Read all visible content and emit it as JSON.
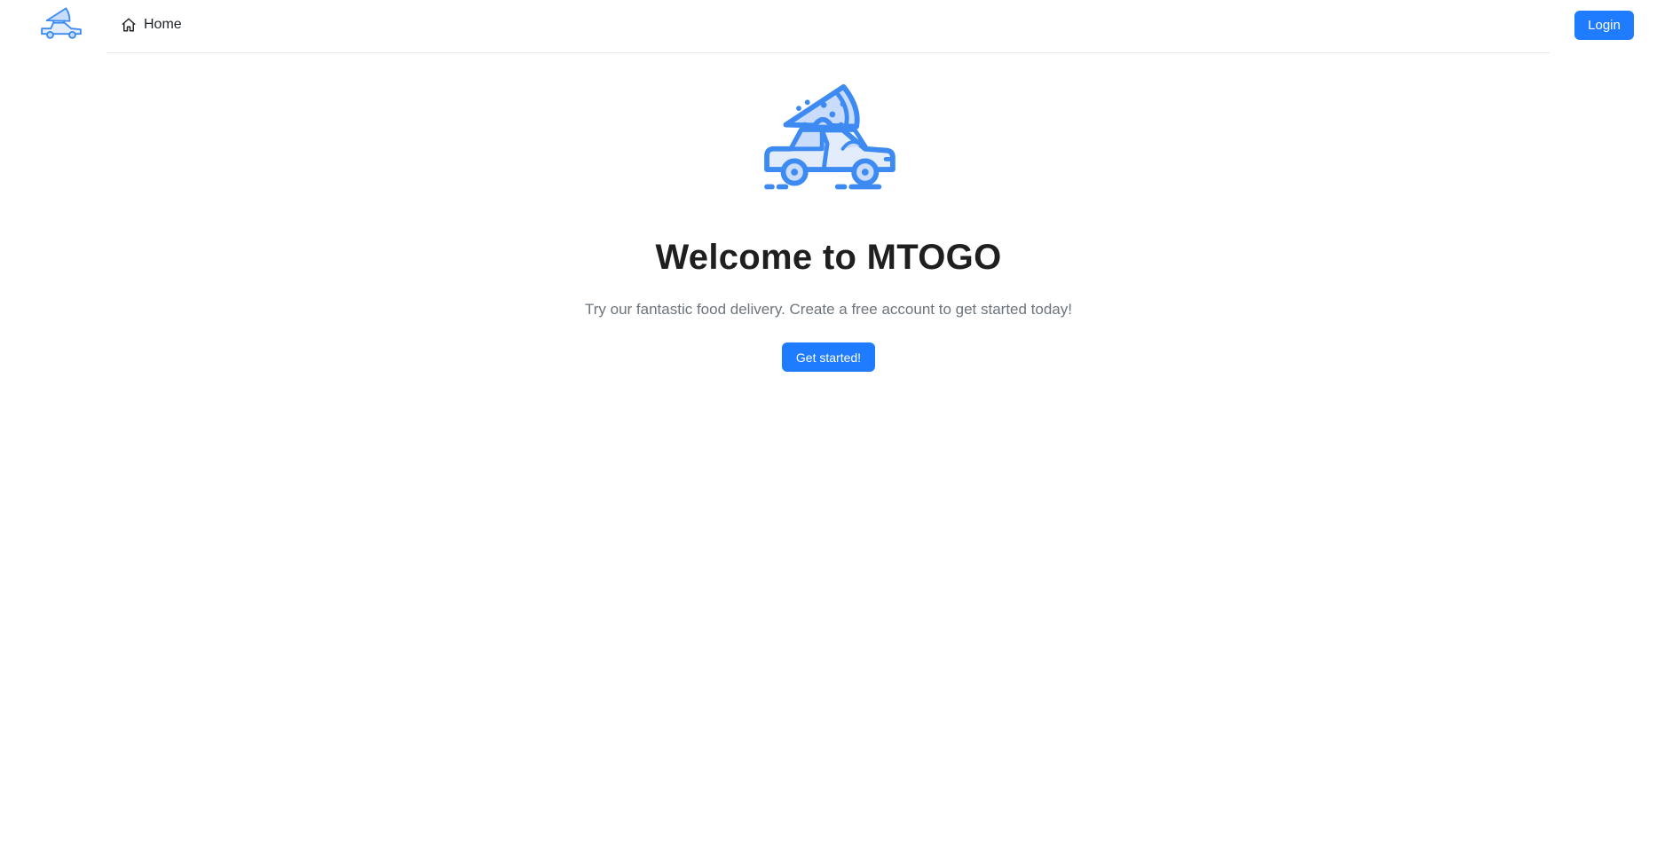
{
  "nav": {
    "home_label": "Home",
    "login_label": "Login",
    "brand_icon": "pizza-delivery-car-icon"
  },
  "hero": {
    "logo_icon": "pizza-delivery-car-icon",
    "title": "Welcome to MTOGO",
    "subtitle": "Try our fantastic food delivery. Create a free account to get started today!",
    "cta_label": "Get started!"
  },
  "colors": {
    "primary": "#1f7cff",
    "logo_stroke": "#3d8bf2",
    "logo_fill": "#c9dcfb",
    "logo_fill_light": "#e2ecfb",
    "title": "#1f1f1f",
    "subtitle": "#6c757d"
  }
}
